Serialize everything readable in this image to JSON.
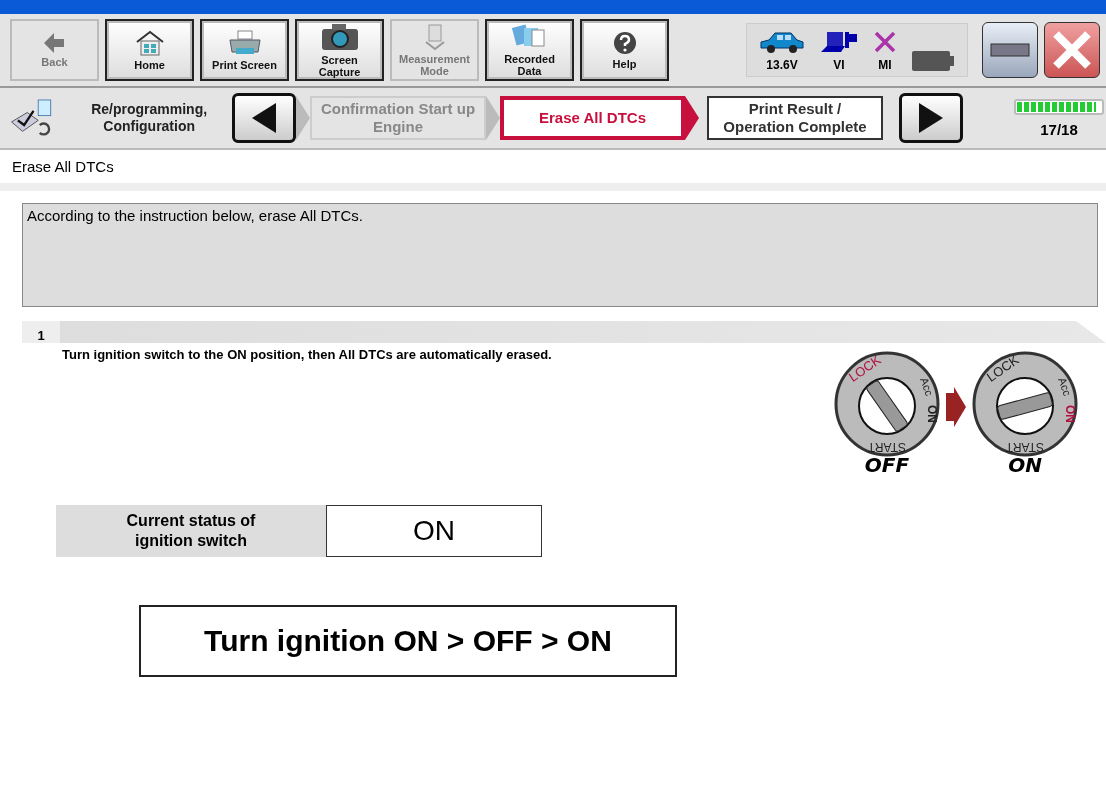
{
  "toolbar": {
    "buttons": [
      {
        "kind": "back",
        "label": "Back",
        "disabled": true
      },
      {
        "kind": "home",
        "label": "Home",
        "disabled": false
      },
      {
        "kind": "print",
        "label": "Print Screen",
        "disabled": false
      },
      {
        "kind": "camera",
        "label": "Screen Capture",
        "disabled": false
      },
      {
        "kind": "measure",
        "label": "Measurement Mode",
        "disabled": true
      },
      {
        "kind": "recorded",
        "label": "Recorded Data",
        "disabled": false
      },
      {
        "kind": "help",
        "label": "Help",
        "disabled": false
      }
    ],
    "status": [
      {
        "kind": "car",
        "label": "13.6V"
      },
      {
        "kind": "vi",
        "label": "VI"
      },
      {
        "kind": "mi",
        "label": "MI"
      },
      {
        "kind": "battery"
      }
    ]
  },
  "steps_bar": {
    "mode": "Re/programming, Configuration",
    "steps": [
      {
        "label": "Confirmation Start up Engine",
        "completed": true,
        "selected": false
      },
      {
        "label": "Erase All DTCs",
        "completed": false,
        "selected": true
      },
      {
        "label": "Print Result / Operation Complete",
        "completed": false,
        "selected": false
      }
    ],
    "progress": {
      "level": 0.94,
      "count": "17/18"
    }
  },
  "page_title": "Erase All DTCs",
  "instruction": "According to the instruction below, erase All DTCs.",
  "step": {
    "number": "1",
    "text": "Turn ignition switch to the ON position, then All DTCs are automatically erased."
  },
  "illustration": [
    {
      "caption": "OFF",
      "switched_on": false,
      "lock": "LOCK",
      "acc": "Acc",
      "on": "ON",
      "start": "START"
    },
    {
      "caption": "ON",
      "switched_on": true,
      "lock": "LOCK",
      "acc": "Acc",
      "on": "ON",
      "start": "START"
    }
  ],
  "ignition_status": {
    "label": "Current status of ignition switch",
    "value": "ON"
  },
  "message": "Turn ignition ON > OFF > ON"
}
